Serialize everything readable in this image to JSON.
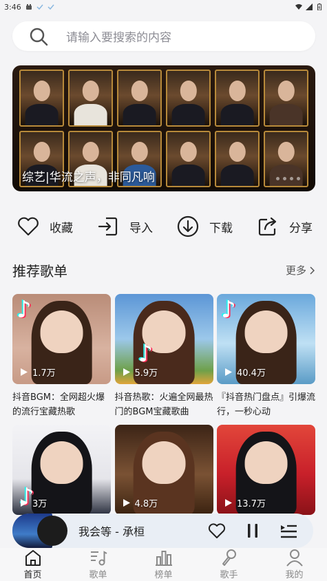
{
  "status_bar": {
    "time": "3:46"
  },
  "search": {
    "placeholder": "请输入要搜索的内容",
    "icon": "search-icon"
  },
  "banner": {
    "caption": "综艺|华流之声，非同凡响"
  },
  "actions": [
    {
      "label": "收藏",
      "icon": "heart-icon"
    },
    {
      "label": "导入",
      "icon": "import-icon"
    },
    {
      "label": "下载",
      "icon": "download-icon"
    },
    {
      "label": "分享",
      "icon": "share-icon"
    }
  ],
  "recommended": {
    "title": "推荐歌单",
    "more_label": "更多",
    "playlists": [
      {
        "title": "抖音BGM：全网超火爆的流行宝藏热歌",
        "plays": "1.7万"
      },
      {
        "title": "抖音热歌：火遍全网最热门的BGM宝藏歌曲",
        "plays": "5.9万"
      },
      {
        "title": "『抖音热门盘点』引爆流行，一秒心动",
        "plays": "40.4万"
      },
      {
        "title": "",
        "plays": "3万"
      },
      {
        "title": "",
        "plays": "4.8万"
      },
      {
        "title": "",
        "plays": "13.7万"
      }
    ]
  },
  "player": {
    "now_playing": "我会等 - 承桓"
  },
  "tabbar": [
    {
      "label": "首页",
      "icon": "home-icon",
      "active": true
    },
    {
      "label": "歌单",
      "icon": "playlist-icon",
      "active": false
    },
    {
      "label": "榜单",
      "icon": "chart-icon",
      "active": false
    },
    {
      "label": "歌手",
      "icon": "singer-icon",
      "active": false
    },
    {
      "label": "我的",
      "icon": "profile-icon",
      "active": false
    }
  ],
  "colors": {
    "background": "#f4f4f6",
    "player_bg": "#e9eef5",
    "text": "#222222",
    "muted": "#8a8a8a"
  }
}
